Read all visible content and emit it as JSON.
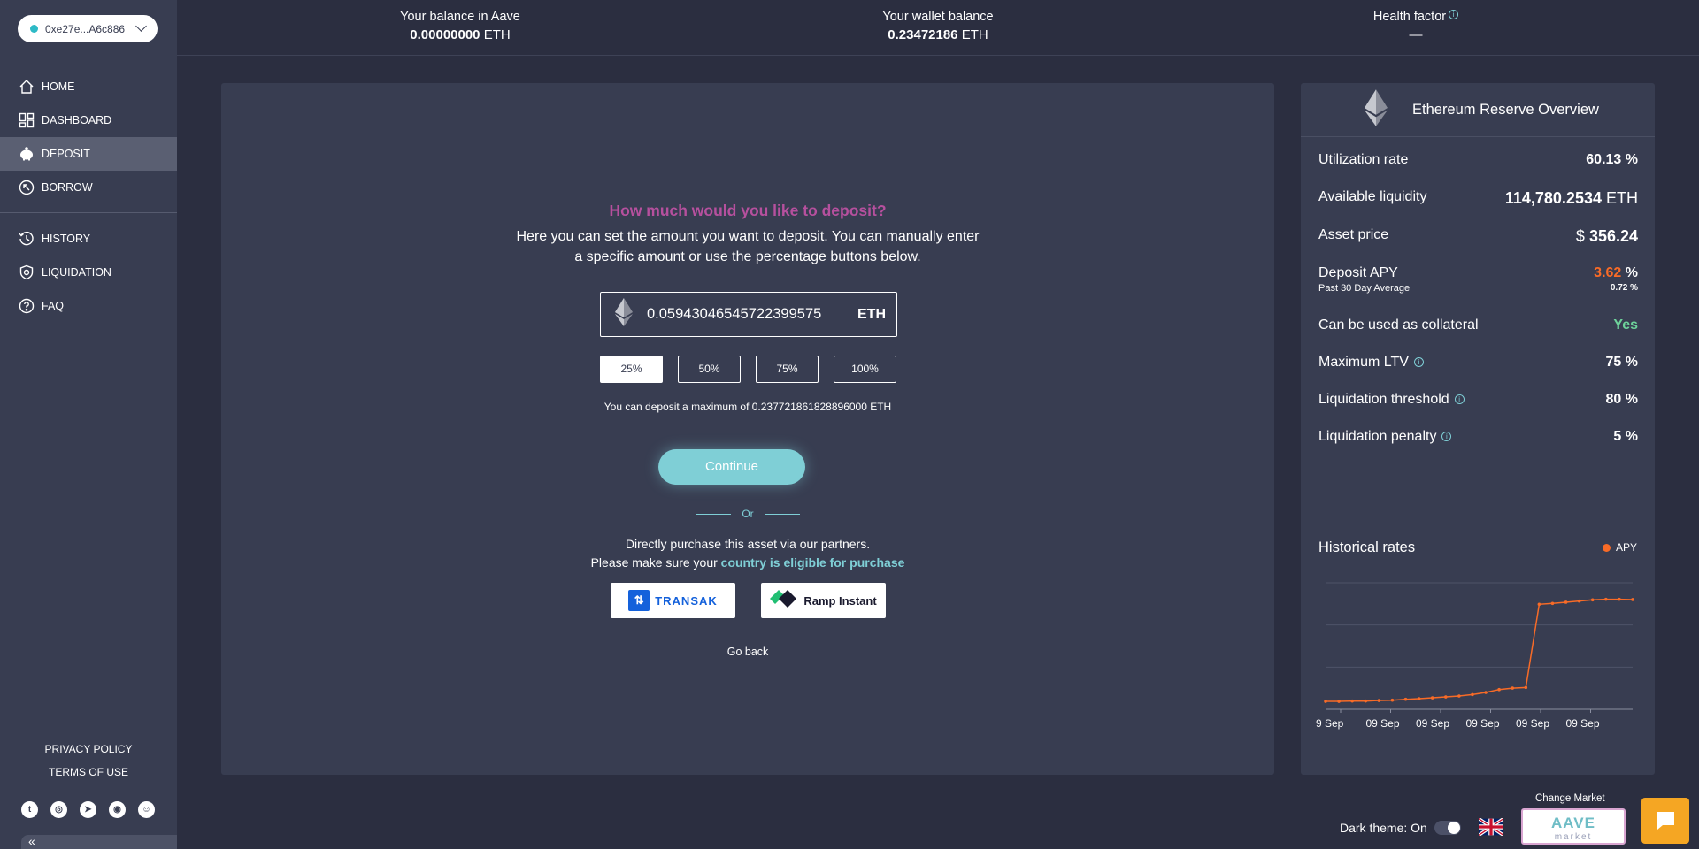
{
  "sidebar": {
    "wallet_address": "0xe27e...A6c886",
    "nav": [
      {
        "label": "HOME",
        "icon": "home-icon"
      },
      {
        "label": "DASHBOARD",
        "icon": "dashboard-icon"
      },
      {
        "label": "DEPOSIT",
        "icon": "piggy-bank-icon",
        "active": true
      },
      {
        "label": "BORROW",
        "icon": "borrow-icon"
      },
      {
        "label": "HISTORY",
        "icon": "history-icon"
      },
      {
        "label": "LIQUIDATION",
        "icon": "shield-icon"
      },
      {
        "label": "FAQ",
        "icon": "question-icon"
      }
    ],
    "privacy_policy": "PRIVACY POLICY",
    "terms_of_use": "TERMS OF USE",
    "socials": [
      "twitter-icon",
      "instagram-icon",
      "telegram-icon",
      "github-icon",
      "discord-icon"
    ],
    "collapse_label": "«"
  },
  "topbar": {
    "aave_balance_label": "Your balance in Aave",
    "aave_balance_value": "0.00000000",
    "aave_balance_unit": "ETH",
    "wallet_balance_label": "Your wallet balance",
    "wallet_balance_value": "0.23472186",
    "wallet_balance_unit": "ETH",
    "health_factor_label": "Health factor",
    "health_factor_value": "—"
  },
  "deposit": {
    "title": "How much would you like to deposit?",
    "description": "Here you can set the amount you want to deposit. You can manually enter a specific amount or use the percentage buttons below.",
    "amount_value": "0.05943046545722399575",
    "amount_unit": "ETH",
    "percent_buttons": [
      "25%",
      "50%",
      "75%",
      "100%"
    ],
    "selected_percent": "25%",
    "max_note": "You can deposit a maximum of 0.237721861828896000 ETH",
    "continue_label": "Continue",
    "or_label": "Or",
    "partner_line1": "Directly purchase this asset via our partners.",
    "partner_line2_prefix": "Please make sure your ",
    "partner_line2_link": "country is eligible for purchase",
    "partner_transak": "TRANSAK",
    "partner_ramp": "Ramp Instant",
    "go_back": "Go back"
  },
  "reserve": {
    "title": "Ethereum Reserve Overview",
    "utilization_label": "Utilization rate",
    "utilization_value": "60.13",
    "utilization_unit": "%",
    "liquidity_label": "Available liquidity",
    "liquidity_value": "114,780.2534",
    "liquidity_unit": "ETH",
    "price_label": "Asset price",
    "price_currency": "$",
    "price_value": "356.24",
    "apy_label": "Deposit APY",
    "apy_value": "3.62",
    "apy_unit": "%",
    "apy_sub_label": "Past 30 Day Average",
    "apy_sub_value": "0.72 %",
    "collateral_label": "Can be used as collateral",
    "collateral_value": "Yes",
    "ltv_label": "Maximum LTV",
    "ltv_value": "75 %",
    "threshold_label": "Liquidation threshold",
    "threshold_value": "80 %",
    "penalty_label": "Liquidation penalty",
    "penalty_value": "5 %",
    "historical_label": "Historical rates",
    "legend_label": "APY",
    "accent_color": "#f86b27",
    "positive_color": "#6ed39b"
  },
  "chart_data": {
    "type": "line",
    "x_tick_labels": [
      "9 Sep",
      "09 Sep",
      "09 Sep",
      "09 Sep",
      "09 Sep",
      "09 Sep"
    ],
    "series": [
      {
        "name": "APY",
        "values": [
          0.15,
          0.15,
          0.16,
          0.16,
          0.18,
          0.19,
          0.22,
          0.24,
          0.27,
          0.3,
          0.33,
          0.38,
          0.45,
          0.55,
          0.6,
          0.62,
          3.45,
          3.48,
          3.52,
          3.56,
          3.6,
          3.62,
          3.62,
          3.61
        ]
      }
    ],
    "gridlines": true
  },
  "bottom": {
    "dark_theme_label": "Dark theme: On",
    "change_market_label": "Change Market",
    "market_name": "AAVE",
    "market_sub": "market"
  }
}
